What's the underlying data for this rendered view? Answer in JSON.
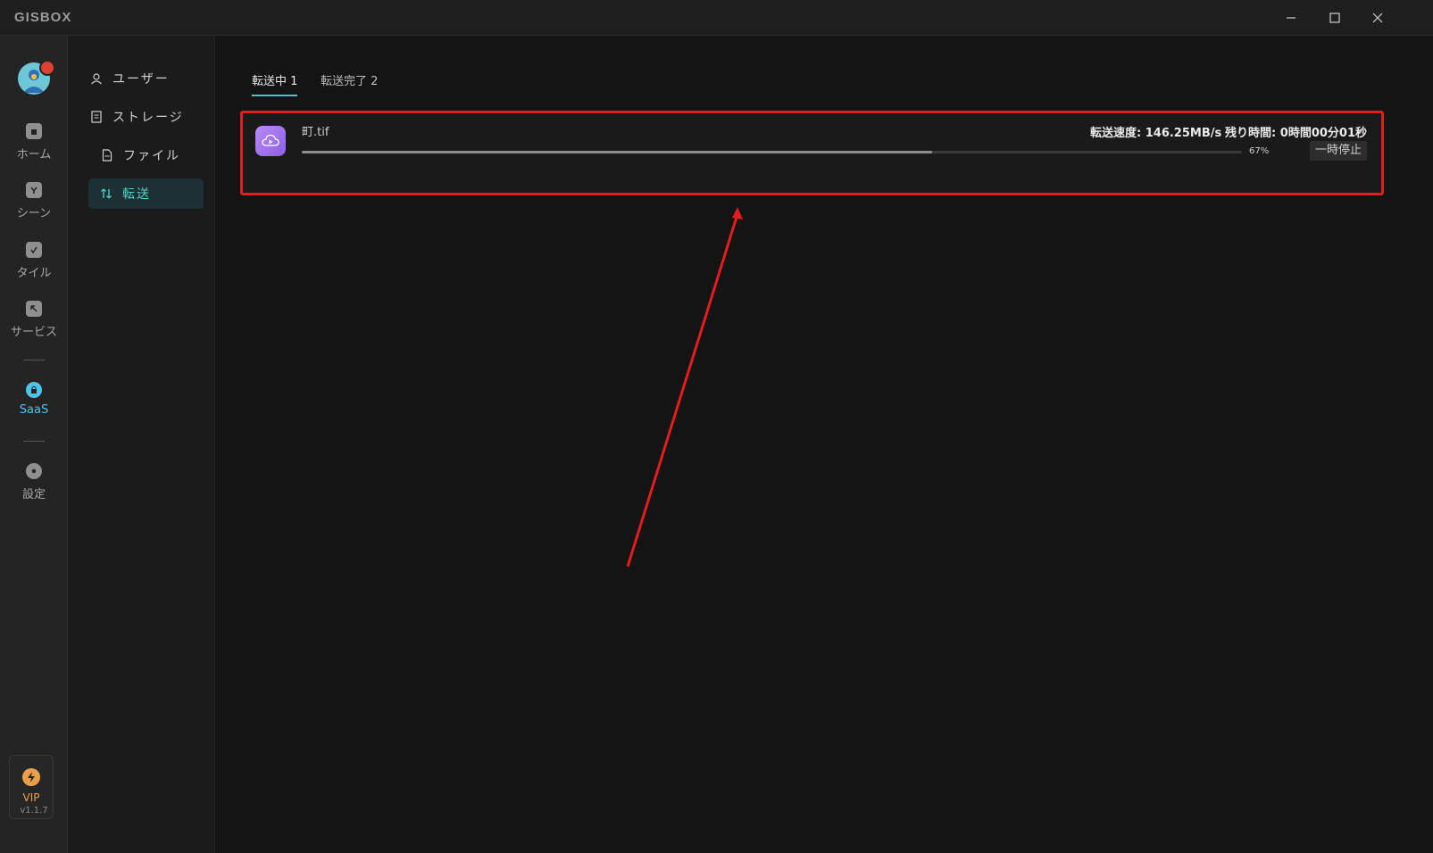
{
  "app": {
    "logo_text": "GISBOX"
  },
  "window_controls": {
    "minimize": "minimize-icon",
    "maximize": "maximize-icon",
    "close": "close-icon"
  },
  "rail": {
    "items": [
      {
        "label": "ホーム",
        "icon": "home-icon"
      },
      {
        "label": "シーン",
        "icon": "scene-icon"
      },
      {
        "label": "タイル",
        "icon": "tile-icon"
      },
      {
        "label": "サービス",
        "icon": "service-icon"
      },
      {
        "label": "SaaS",
        "icon": "saas-icon"
      },
      {
        "label": "設定",
        "icon": "settings-icon"
      }
    ],
    "vip_label": "VIP",
    "version": "v1.1.7"
  },
  "subnav": {
    "items": [
      {
        "label": "ユーザー",
        "icon": "user-icon"
      },
      {
        "label": "ストレージ",
        "icon": "storage-icon"
      },
      {
        "label": "ファイル",
        "icon": "file-icon"
      },
      {
        "label": "転送",
        "icon": "transfer-icon",
        "active": true
      }
    ]
  },
  "tabs": [
    {
      "label": "転送中 1",
      "active": true
    },
    {
      "label": "転送完了 2",
      "active": false
    }
  ],
  "transfer": {
    "file_name": "町.tif",
    "speed": "転送速度: 146.25MB/s",
    "remaining": "残り時間: 0時間00分01秒",
    "progress": 0.67,
    "percent_label": "67%",
    "pause_label": "一時停止"
  },
  "colors": {
    "accent": "#4fc3c9",
    "highlight": "#e21d1d",
    "vip": "#e9a04a"
  }
}
